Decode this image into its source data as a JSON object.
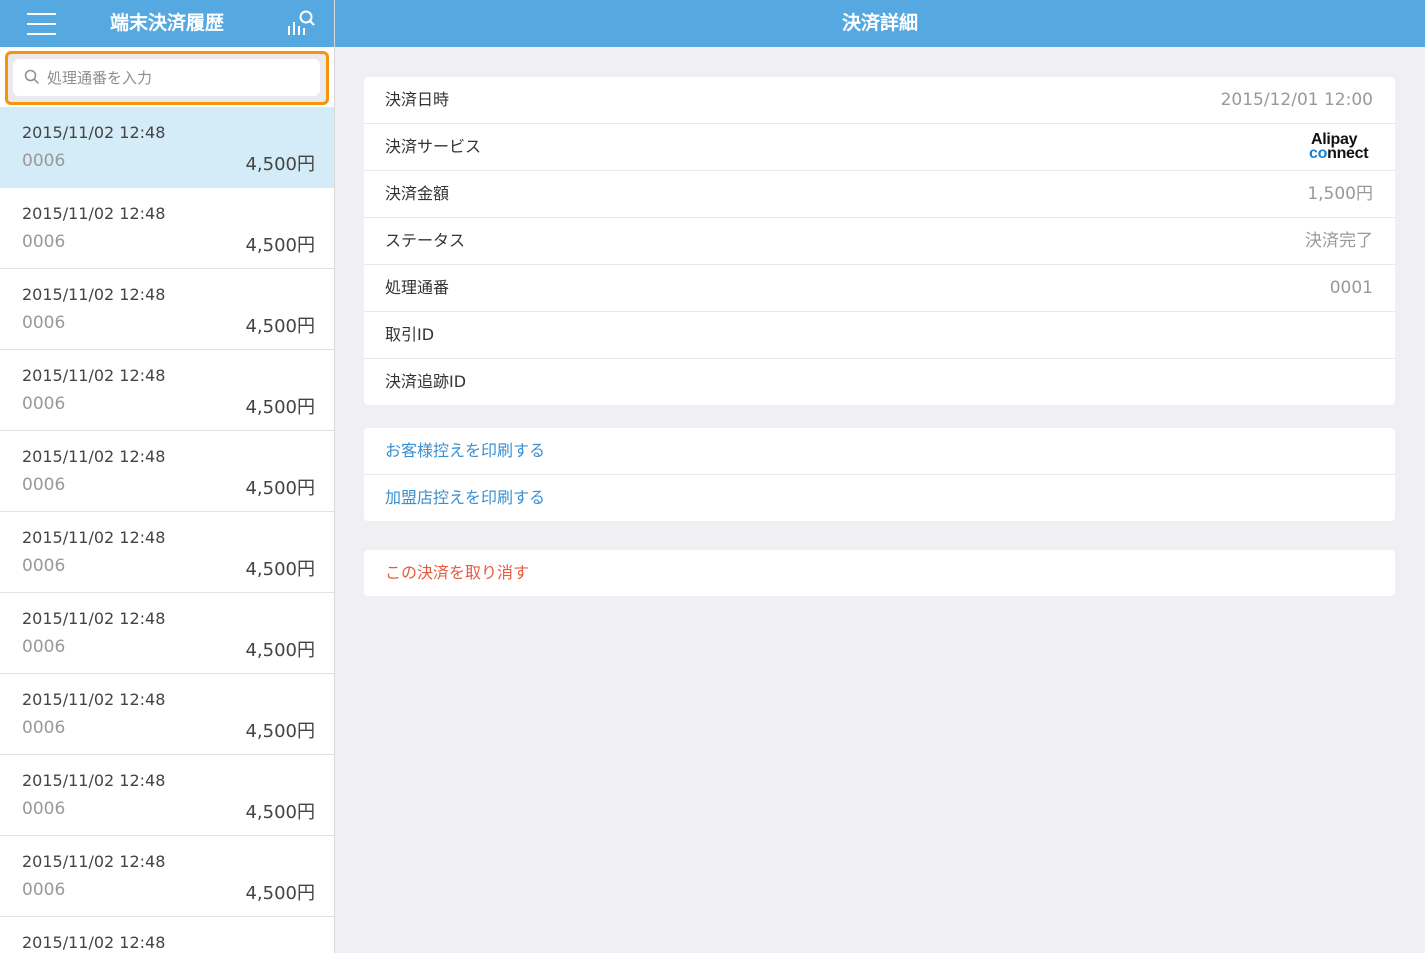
{
  "sidebar": {
    "title": "端末決済履歴",
    "search": {
      "placeholder": "処理通番を入力",
      "value": ""
    },
    "items": [
      {
        "date": "2015/11/02 12:48",
        "number": "0006",
        "amount": "4,500円"
      },
      {
        "date": "2015/11/02 12:48",
        "number": "0006",
        "amount": "4,500円"
      },
      {
        "date": "2015/11/02 12:48",
        "number": "0006",
        "amount": "4,500円"
      },
      {
        "date": "2015/11/02 12:48",
        "number": "0006",
        "amount": "4,500円"
      },
      {
        "date": "2015/11/02 12:48",
        "number": "0006",
        "amount": "4,500円"
      },
      {
        "date": "2015/11/02 12:48",
        "number": "0006",
        "amount": "4,500円"
      },
      {
        "date": "2015/11/02 12:48",
        "number": "0006",
        "amount": "4,500円"
      },
      {
        "date": "2015/11/02 12:48",
        "number": "0006",
        "amount": "4,500円"
      },
      {
        "date": "2015/11/02 12:48",
        "number": "0006",
        "amount": "4,500円"
      },
      {
        "date": "2015/11/02 12:48",
        "number": "0006",
        "amount": "4,500円"
      },
      {
        "date": "2015/11/02 12:48",
        "number": "",
        "amount": ""
      }
    ]
  },
  "main": {
    "title": "決済詳細",
    "details": {
      "datetime": {
        "label": "決済日時",
        "value": "2015/12/01 12:00"
      },
      "service": {
        "label": "決済サービス",
        "logo_line1": "Alipay",
        "logo_line2_c": "c",
        "logo_line2_o": "o",
        "logo_line2_rest": "nnect"
      },
      "amount": {
        "label": "決済金額",
        "value": "1,500円"
      },
      "status": {
        "label": "ステータス",
        "value": "決済完了"
      },
      "process_no": {
        "label": "処理通番",
        "value": "0001"
      },
      "transaction_id": {
        "label": "取引ID",
        "value": ""
      },
      "tracking_id": {
        "label": "決済追跡ID",
        "value": ""
      }
    },
    "actions": {
      "print_customer": "お客様控えを印刷する",
      "print_merchant": "加盟店控えを印刷する",
      "cancel_payment": "この決済を取り消す"
    }
  },
  "colors": {
    "header": "#56a9e0",
    "highlight": "#f5940f",
    "selected_row": "#d4ebf8",
    "link": "#3a8fd0",
    "danger": "#e8593f"
  },
  "icons": {
    "menu": "hamburger-menu-icon",
    "filter": "search-filter-icon",
    "search": "search-icon"
  }
}
